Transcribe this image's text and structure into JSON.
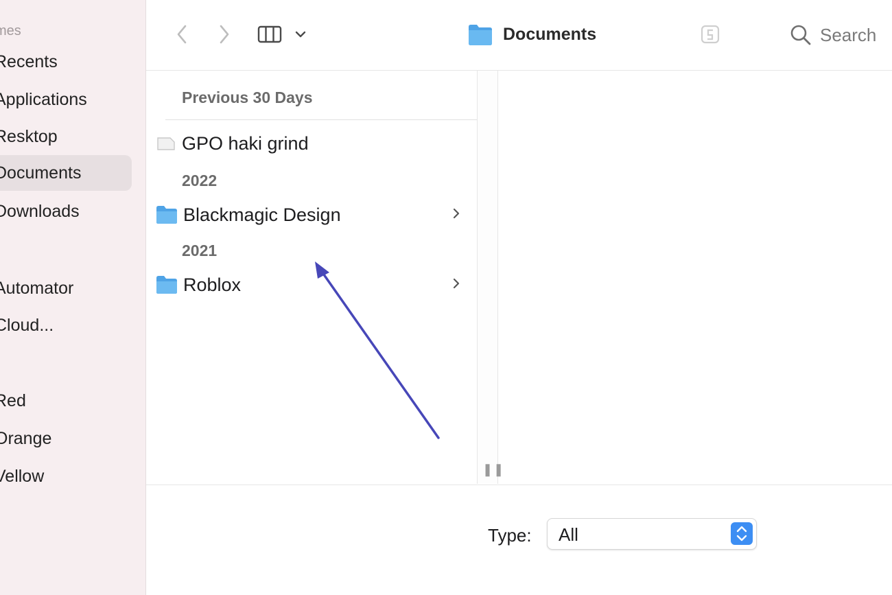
{
  "sidebar": {
    "header": "mes",
    "favorites": [
      "Recents",
      "Applications",
      "Resktop",
      "Documents",
      "Downloads"
    ],
    "locations": [
      "Automator",
      "Cloud..."
    ],
    "tags": [
      "Red",
      "Orange",
      "Vellow"
    ]
  },
  "toolbar": {
    "title": "Documents",
    "search_label": "Search"
  },
  "browser": {
    "sections": [
      {
        "heading": "Previous 30 Days",
        "items": [
          {
            "name": "GPO haki grind",
            "kind": "document"
          }
        ]
      },
      {
        "heading": "2022",
        "items": [
          {
            "name": "Blackmagic Design",
            "kind": "folder"
          }
        ]
      },
      {
        "heading": "2021",
        "items": [
          {
            "name": "Roblox",
            "kind": "folder"
          }
        ]
      }
    ]
  },
  "filter": {
    "label": "Type:",
    "value": "All"
  },
  "colors": {
    "accent": "#3d8ef3",
    "folder": "#5aaeea",
    "annotation_arrow": "#4747b8"
  },
  "icons": [
    "chevron-left-icon",
    "chevron-right-icon",
    "column-view-icon",
    "chevron-down-icon",
    "folder-icon",
    "share-icon",
    "search-icon",
    "document-icon"
  ]
}
